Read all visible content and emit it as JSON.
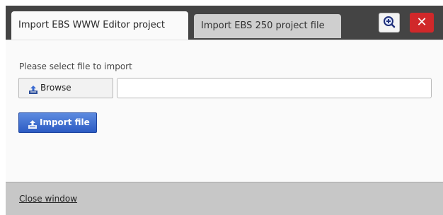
{
  "tabs": [
    {
      "label": "Import EBS WWW Editor project",
      "active": true
    },
    {
      "label": "Import EBS 250 project file",
      "active": false
    }
  ],
  "header_buttons": {
    "zoom_icon": "magnifier-plus-icon",
    "close_icon": "close-x-icon",
    "close_symbol": "✕"
  },
  "main": {
    "prompt": "Please select file to import",
    "browse_label": "Browse",
    "file_value": "",
    "import_label": "Import file"
  },
  "footer": {
    "close_link": "Close window"
  },
  "colors": {
    "topbar": "#444444",
    "close_button": "#d0282a",
    "import_button": "#3a68cf",
    "footer": "#c7c7c7"
  }
}
